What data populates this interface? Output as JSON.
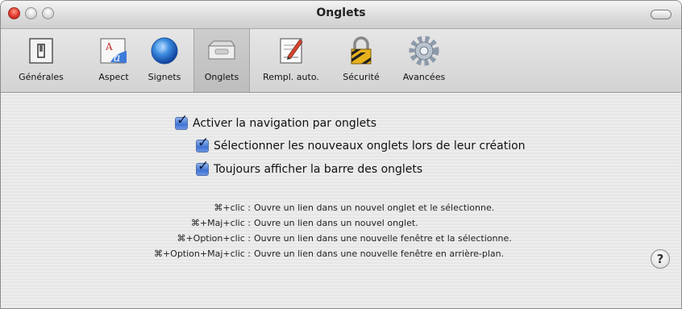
{
  "window": {
    "title": "Onglets"
  },
  "toolbar": {
    "items": [
      {
        "label": "Générales",
        "icon": "switch-icon"
      },
      {
        "label": "Aspect",
        "icon": "font-icon"
      },
      {
        "label": "Signets",
        "icon": "globe-icon"
      },
      {
        "label": "Onglets",
        "icon": "tabs-icon",
        "selected": true
      },
      {
        "label": "Rempl. auto.",
        "icon": "pencil-form-icon"
      },
      {
        "label": "Sécurité",
        "icon": "lock-icon"
      },
      {
        "label": "Avancées",
        "icon": "gear-icon"
      }
    ]
  },
  "options": {
    "enable_tabs": {
      "label": "Activer la navigation par onglets",
      "checked": true
    },
    "select_new_tabs": {
      "label": "Sélectionner les nouveaux onglets lors de leur création",
      "checked": true
    },
    "always_show_tab_bar": {
      "label": "Toujours afficher la barre des onglets",
      "checked": true
    }
  },
  "shortcuts": [
    {
      "keys": "⌘+clic :",
      "desc": "Ouvre un lien dans un nouvel onglet et le sélectionne."
    },
    {
      "keys": "⌘+Maj+clic :",
      "desc": "Ouvre un lien dans un nouvel onglet."
    },
    {
      "keys": "⌘+Option+clic :",
      "desc": "Ouvre un lien dans une nouvelle fenêtre et la sélectionne."
    },
    {
      "keys": "⌘+Option+Maj+clic :",
      "desc": "Ouvre un lien dans une nouvelle fenêtre en arrière-plan."
    }
  ],
  "help": {
    "symbol": "?"
  },
  "colors": {
    "checkbox_blue": "#3f73d2",
    "close_red": "#e0382b"
  }
}
